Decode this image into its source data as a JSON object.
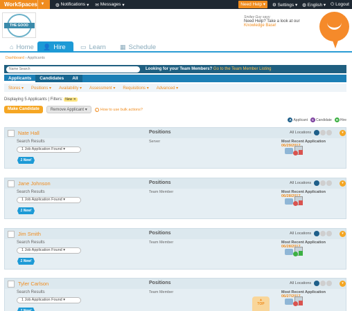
{
  "topbar": {
    "workspaces": "WorkSpaces",
    "notifications": "Notifications",
    "messages": "Messages",
    "need_help": "Need Help",
    "settings": "Settings",
    "language": "English",
    "logout": "Logout"
  },
  "logo": {
    "line1": "THE GOOD",
    "line2": ""
  },
  "smiley": {
    "says": "Smiley Guy says:",
    "text": "Need Help? Take a look at our",
    "link": "Knowledge Base!"
  },
  "tabs": [
    {
      "label": "Home",
      "icon": "home-icon"
    },
    {
      "label": "Hire",
      "icon": "person-icon"
    },
    {
      "label": "Learn",
      "icon": "book-icon"
    },
    {
      "label": "Schedule",
      "icon": "calendar-icon"
    }
  ],
  "breadcrumb": {
    "home": "Dashboard",
    "sep": "›",
    "current": "Applicants"
  },
  "search": {
    "placeholder": "Name Search",
    "prompt": "Looking for your Team Members?",
    "link": "Go to the Team Member Listing"
  },
  "subtabs": [
    "Applicants",
    "Candidates",
    "All"
  ],
  "filters": [
    "Stores ▾",
    "Positions ▾",
    "Availability ▾",
    "Assessment ▾",
    "Requisitions ▾",
    "Advanced ▾"
  ],
  "summary": {
    "text": "Displaying 5 Applicants | Filters:",
    "tag": "New ✕"
  },
  "actions": {
    "make_candidate": "Make Candidate",
    "remove_applicant": "Remove Applicant ▾",
    "bulk_help": "How to use bulk actions?"
  },
  "legend": [
    {
      "letter": "A",
      "label": "Applicant",
      "color": "#1e5f8a"
    },
    {
      "letter": "C",
      "label": "Candidate",
      "color": "#7b3f9e"
    },
    {
      "letter": "H",
      "label": "Hire",
      "color": "#3cb043"
    }
  ],
  "card_labels": {
    "positions": "Positions",
    "all_locations": "All Locations",
    "search_results": "Search Results",
    "recent": "Most Recent Application",
    "job_found": "1 Job Application Found ▾",
    "new_badge": "1 New!"
  },
  "applicants": [
    {
      "name": "Nate Hall",
      "role": "Server",
      "date": "06/29/2017"
    },
    {
      "name": "Jane Johnson",
      "role": "Team Member",
      "date": "06/28/2017"
    },
    {
      "name": "Jim Smith",
      "role": "Team Member",
      "date": "06/28/2017"
    },
    {
      "name": "Tyler Carlson",
      "role": "Team Member",
      "date": "06/27/2017"
    }
  ],
  "top_button": "TOP"
}
